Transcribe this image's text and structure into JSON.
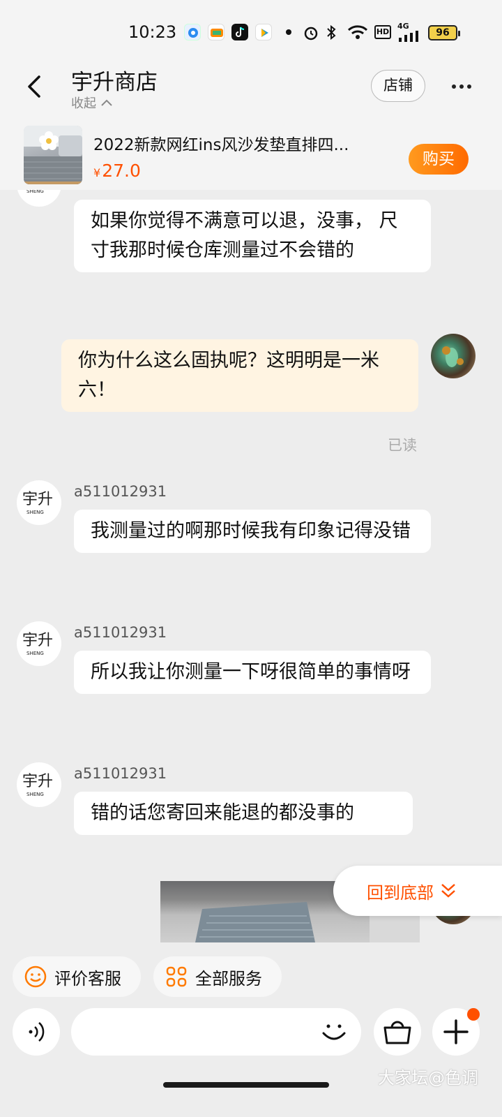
{
  "status_bar": {
    "time": "10:23",
    "network": "4G",
    "hd": "HD",
    "battery": "96"
  },
  "header": {
    "title": "宇升商店",
    "collapse_label": "收起",
    "store_button": "店铺"
  },
  "product": {
    "name": "2022新款网红ins风沙发垫直排四...",
    "currency": "¥",
    "price": "27.0",
    "buy_button": "购买"
  },
  "messages": [
    {
      "from": "shop",
      "sender": "",
      "text": "如果你觉得不满意可以退，没事， 尺寸我那时候仓库测量过不会错的"
    },
    {
      "from": "me",
      "text": "你为什么这么固执呢？这明明是一米六！",
      "status": "已读"
    },
    {
      "from": "shop",
      "sender": "a511012931",
      "text": "我测量过的啊那时候我有印象记得没错"
    },
    {
      "from": "shop",
      "sender": "a511012931",
      "text": "所以我让你测量一下呀很简单的事情呀"
    },
    {
      "from": "shop",
      "sender": "a511012931",
      "text": "错的话您寄回来能退的都没事的"
    }
  ],
  "shop_avatar_text": {
    "main": "宇升",
    "sub": "SHENG"
  },
  "back_to_bottom": "回到底部",
  "quick_actions": [
    {
      "label": "评价客服",
      "icon": "smile-icon"
    },
    {
      "label": "全部服务",
      "icon": "grid-icon"
    }
  ],
  "input": {
    "placeholder": ""
  },
  "watermark": "大家坛@色调",
  "colors": {
    "accent": "#ff5000",
    "buy_gradient": "#ff8a00",
    "my_bubble": "#fff4e2",
    "background": "#ededed"
  }
}
